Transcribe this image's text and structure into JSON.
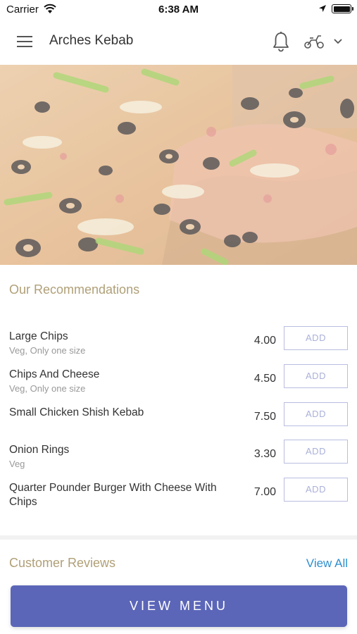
{
  "status_bar": {
    "carrier": "Carrier",
    "time": "6:38 AM"
  },
  "header": {
    "title": "Arches Kebab",
    "icons": [
      "menu-icon",
      "bell-icon",
      "scooter-icon",
      "chevron-down-icon"
    ]
  },
  "hero": {
    "image": "pizza"
  },
  "recommendations": {
    "title": "Our Recommendations",
    "items": [
      {
        "name": "Large Chips",
        "sub": "Veg, Only one size",
        "price": "4.00",
        "add": "ADD"
      },
      {
        "name": "Chips And Cheese",
        "sub": "Veg, Only one size",
        "price": "4.50",
        "add": "ADD"
      },
      {
        "name": "Small Chicken Shish Kebab",
        "sub": "",
        "price": "7.50",
        "add": "ADD"
      },
      {
        "name": "Onion Rings",
        "sub": "Veg",
        "price": "3.30",
        "add": "ADD"
      },
      {
        "name": "Quarter Pounder Burger With Cheese With Chips",
        "sub": "",
        "price": "7.00",
        "add": "ADD"
      }
    ]
  },
  "reviews": {
    "title": "Customer Reviews",
    "view_all": "View All"
  },
  "footer": {
    "view_menu": "VIEW MENU"
  },
  "colors": {
    "accent": "#5b66b8",
    "section_title": "#b0a078",
    "link": "#2f8fcf"
  }
}
